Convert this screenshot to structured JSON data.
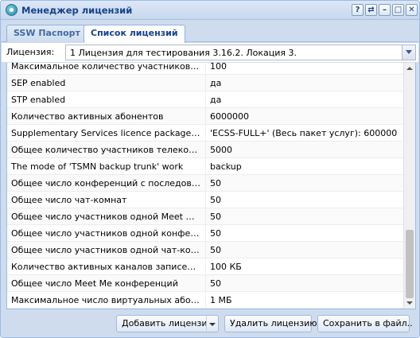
{
  "window": {
    "title": "Менеджер лицензий",
    "tools": [
      "?",
      "⇄",
      "–",
      "□",
      "✕"
    ]
  },
  "tabs": [
    {
      "label": "SSW Паспорт",
      "active": false
    },
    {
      "label": "Список лицензий",
      "active": true
    }
  ],
  "license_select": {
    "label": "Лицензия:",
    "value": "1 Лицензия для тестирования 3.16.2. Локация 3."
  },
  "table": {
    "rows": [
      {
        "name": "Максимальное количество участников в теле...",
        "value": "100"
      },
      {
        "name": "SEP enabled",
        "value": "да"
      },
      {
        "name": "STP enabled",
        "value": "да"
      },
      {
        "name": "Количество активных абонентов",
        "value": "6000000"
      },
      {
        "name": "Supplementary Services licence package(s)",
        "value": "'ECSS-FULL+' (Весь пакет услуг): 600000"
      },
      {
        "name": "Общее количество участников телеконфере...",
        "value": "5000"
      },
      {
        "name": "The mode of 'TSMN backup trunk' work",
        "value": "backup"
      },
      {
        "name": "Общее число конференций с последователь...",
        "value": "50"
      },
      {
        "name": "Общее число чат-комнат",
        "value": "50"
      },
      {
        "name": "Общее число участников одной Meet Me кон...",
        "value": "50"
      },
      {
        "name": "Общее число участников одной конференц...",
        "value": "50"
      },
      {
        "name": "Общее число участников одной чат-комнаты",
        "value": "50"
      },
      {
        "name": "Количество активных каналов записей разго...",
        "value": "100 КБ"
      },
      {
        "name": "Общее число Meet Me конференций",
        "value": "50"
      },
      {
        "name": "Максимальное число виртуальных абонентов",
        "value": "1 МБ"
      }
    ]
  },
  "footer": {
    "add_label": "Добавить лицензию",
    "delete_label": "Удалить лицензию",
    "save_label": "Сохранить в файл.."
  }
}
